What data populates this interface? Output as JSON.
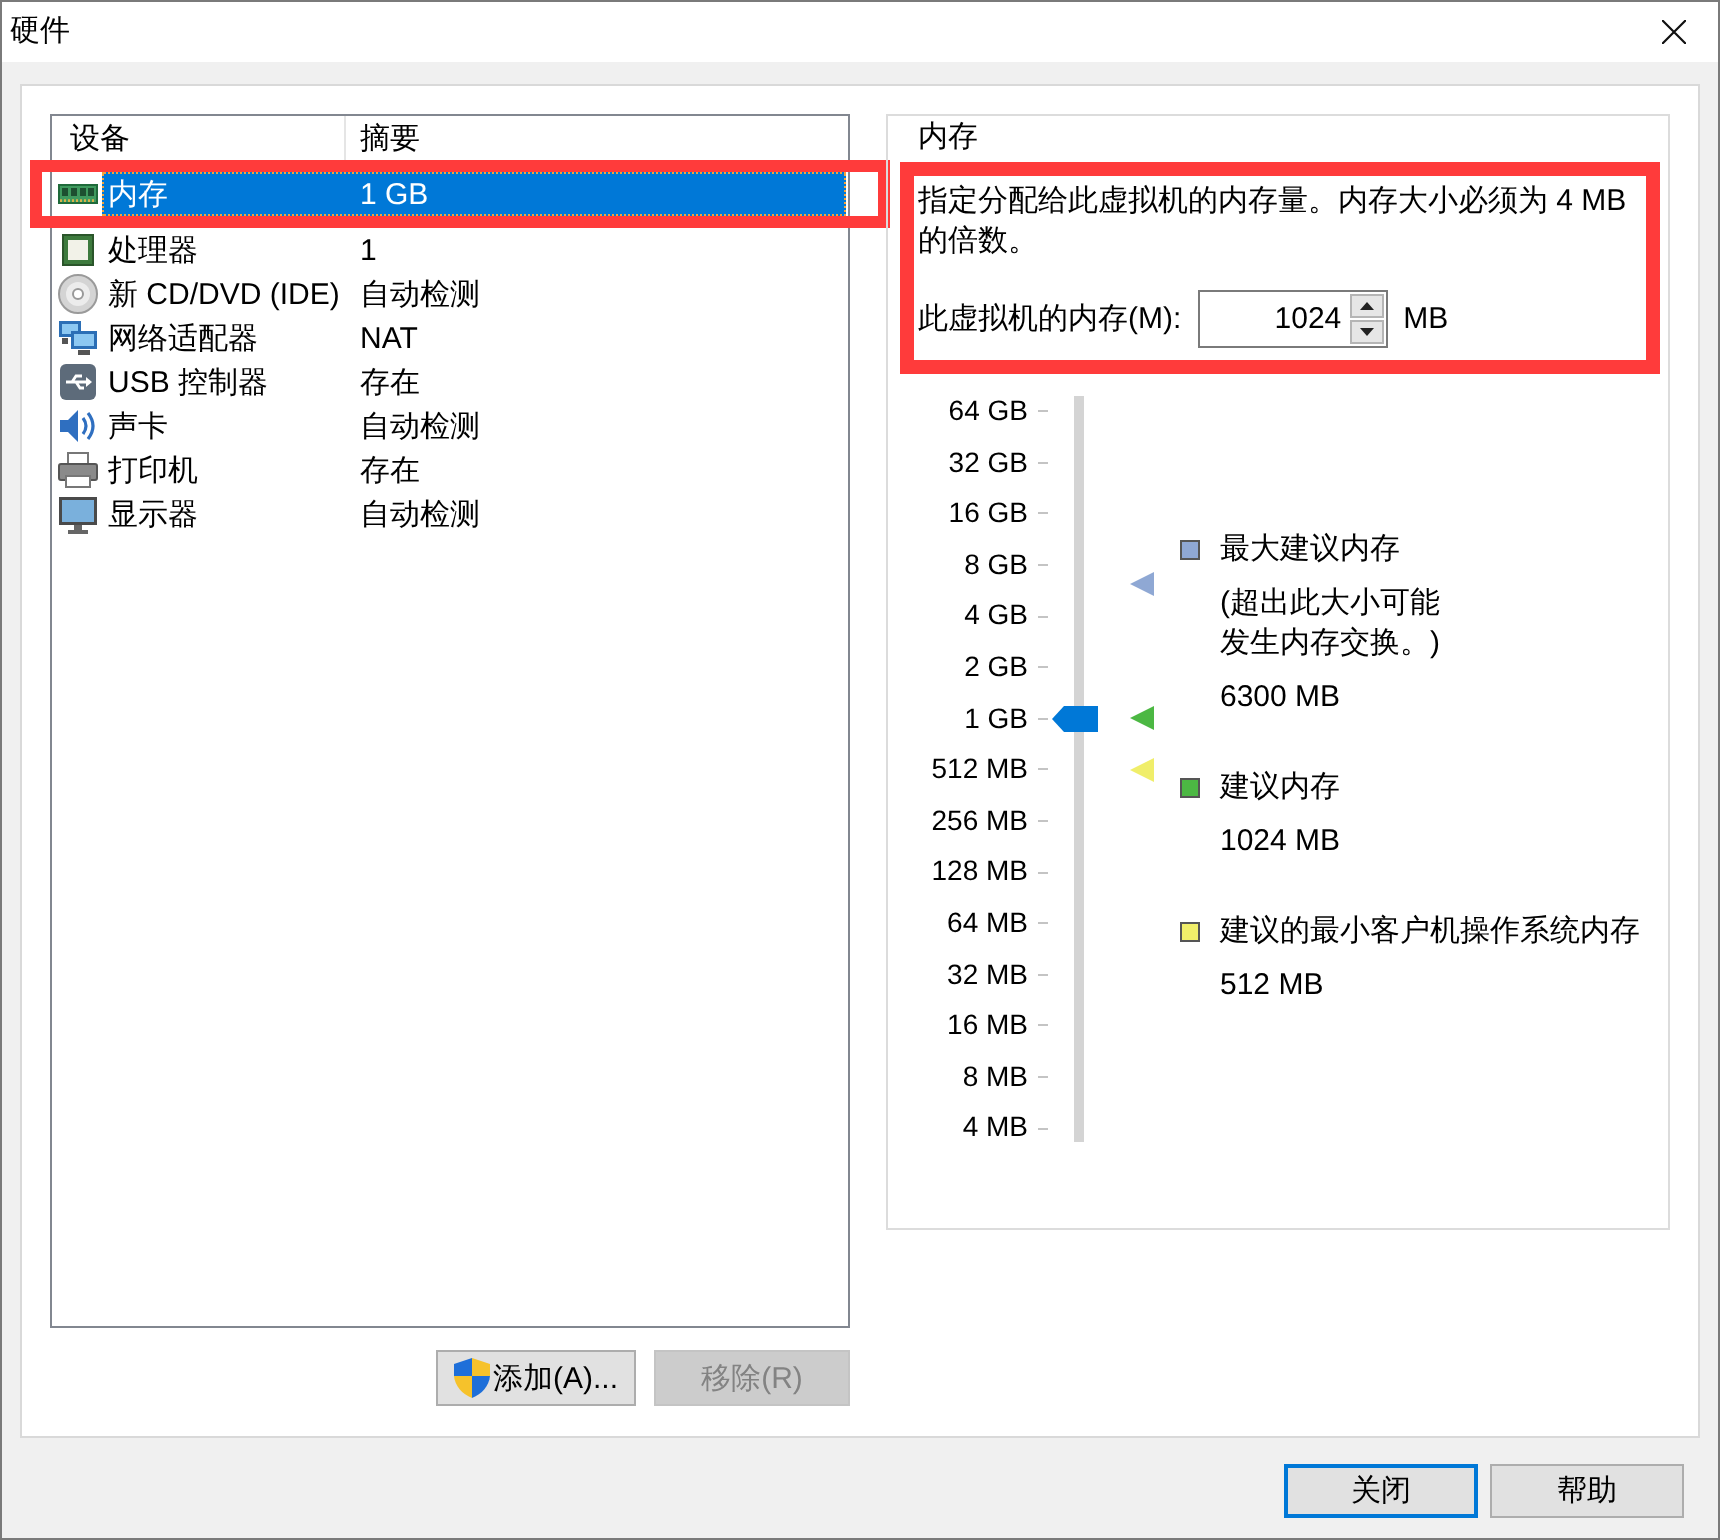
{
  "window": {
    "title": "硬件"
  },
  "device_list": {
    "columns": [
      "设备",
      "摘要"
    ],
    "devices": [
      {
        "kind": "memory",
        "name": "内存",
        "summary": "1 GB",
        "selected": true,
        "highlighted": true
      },
      {
        "kind": "processor",
        "name": "处理器",
        "summary": "1",
        "selected": false,
        "highlighted": false
      },
      {
        "kind": "cdrom",
        "name": "新 CD/DVD (IDE)",
        "summary": "自动检测",
        "selected": false,
        "highlighted": false
      },
      {
        "kind": "network",
        "name": "网络适配器",
        "summary": "NAT",
        "selected": false,
        "highlighted": false
      },
      {
        "kind": "usb",
        "name": "USB 控制器",
        "summary": "存在",
        "selected": false,
        "highlighted": false
      },
      {
        "kind": "sound",
        "name": "声卡",
        "summary": "自动检测",
        "selected": false,
        "highlighted": false
      },
      {
        "kind": "printer",
        "name": "打印机",
        "summary": "存在",
        "selected": false,
        "highlighted": false
      },
      {
        "kind": "display",
        "name": "显示器",
        "summary": "自动检测",
        "selected": false,
        "highlighted": false
      }
    ]
  },
  "list_buttons": [
    {
      "kind": "admin",
      "label": "添加(A)...",
      "disabled": false
    },
    {
      "kind": "plain",
      "label": "移除(R)",
      "disabled": true
    }
  ],
  "memory": {
    "title": "内存",
    "highlighted": true,
    "description": "指定分配给此虚拟机的内存量。内存大小必须为 4 MB 的倍数。",
    "field": {
      "label": "此虚拟机的内存(M):",
      "value": "1024",
      "unit": "MB"
    },
    "slider": {
      "ticks": [
        "64 GB",
        "32 GB",
        "16 GB",
        "8 GB",
        "4 GB",
        "2 GB",
        "1 GB",
        "512 MB",
        "256 MB",
        "128 MB",
        "64 MB",
        "32 MB",
        "16 MB",
        "8 MB",
        "4 MB"
      ],
      "level": 0.5714
    },
    "legend": [
      {
        "color": "#8fa8d4",
        "level": 0.7589,
        "label": "最大建议内存",
        "note": "(超出此大小可能发生内存交换。)",
        "value": "6300 MB"
      },
      {
        "color": "#4cb843",
        "level": 0.5714,
        "label": "建议内存",
        "value": "1024 MB"
      },
      {
        "color": "#f0ee6a",
        "level": 0.5,
        "label": "建议的最小客户机操作系统内存",
        "value": "512 MB"
      }
    ]
  },
  "dialog_buttons": [
    {
      "label": "关闭",
      "default": true
    },
    {
      "label": "帮助",
      "default": false
    }
  ]
}
